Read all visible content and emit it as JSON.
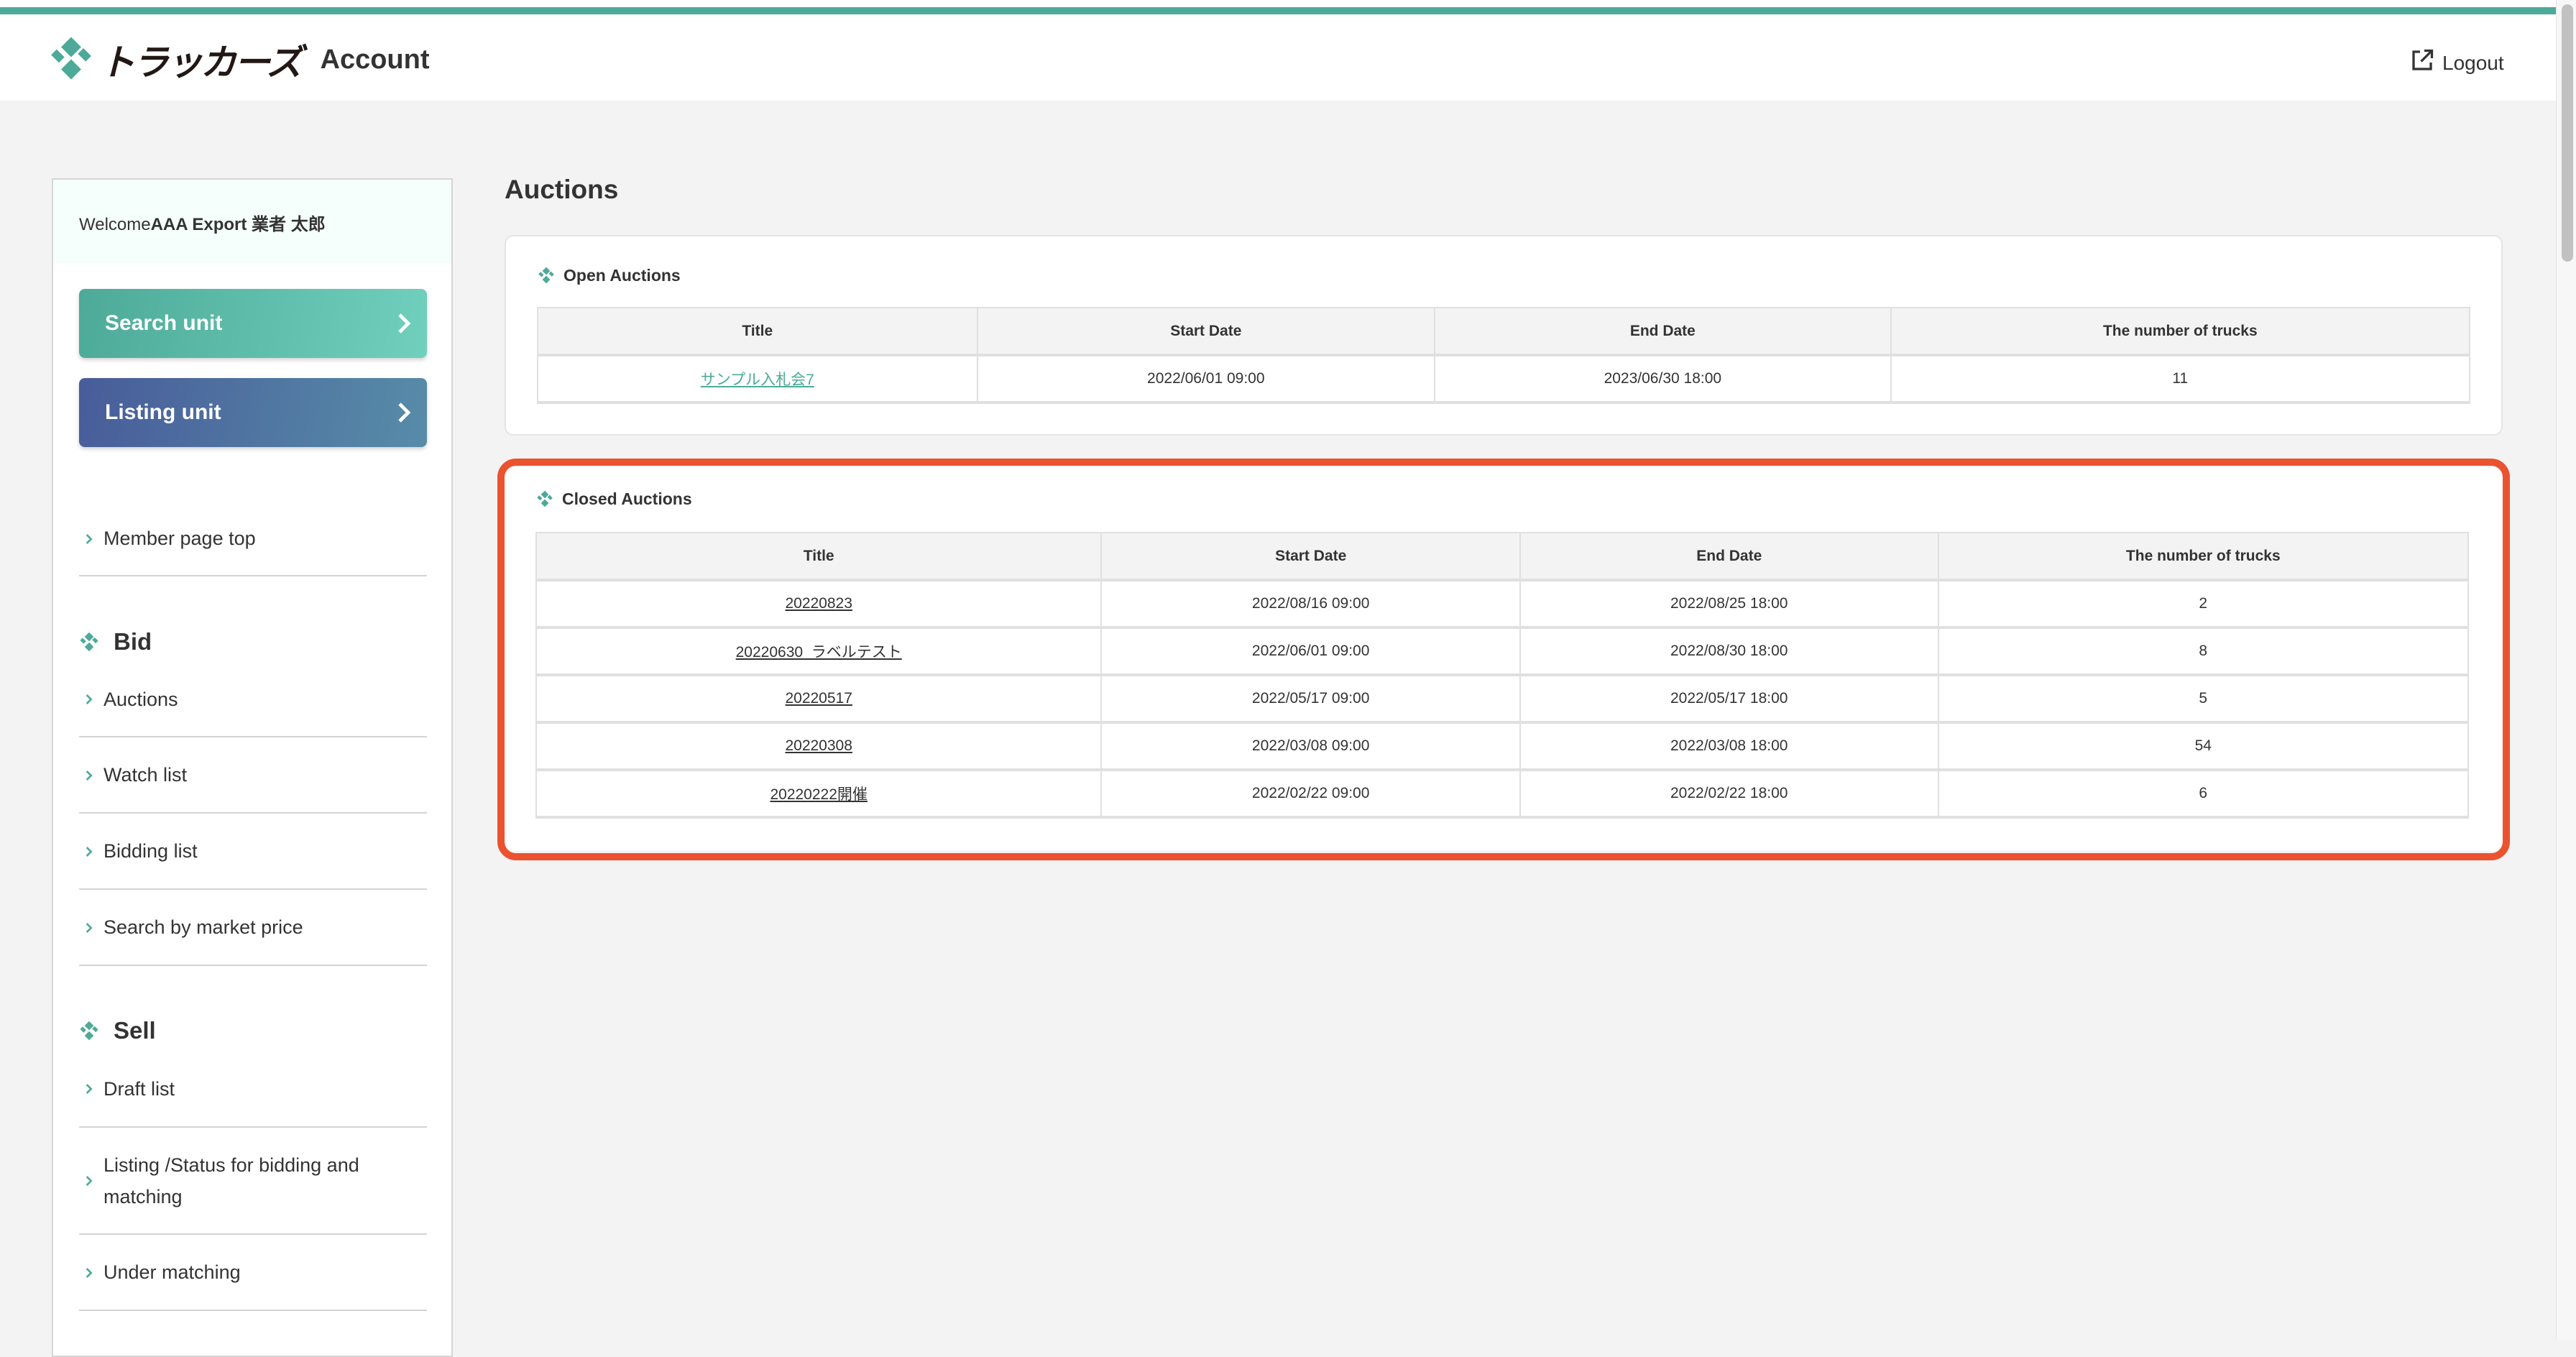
{
  "header": {
    "brand": "トラッカーズ",
    "app_title": "Account",
    "logout_label": "Logout"
  },
  "colors": {
    "accent": "#4daa98",
    "highlight": "#eb5230",
    "listing_button": "#485c9a"
  },
  "sidebar": {
    "welcome_prefix": "Welcome",
    "welcome_name": "AAA Export 業者 太郎",
    "search_unit_label": "Search unit",
    "listing_unit_label": "Listing unit",
    "top_items": [
      {
        "label": "Member page top"
      }
    ],
    "sections": [
      {
        "title": "Bid",
        "items": [
          {
            "label": "Auctions"
          },
          {
            "label": "Watch list"
          },
          {
            "label": "Bidding list"
          },
          {
            "label": "Search by market price"
          }
        ]
      },
      {
        "title": "Sell",
        "items": [
          {
            "label": "Draft list"
          },
          {
            "label": "Listing /Status for bidding and matching"
          },
          {
            "label": "Under matching"
          }
        ]
      }
    ]
  },
  "main": {
    "title": "Auctions",
    "open": {
      "title": "Open Auctions",
      "columns": [
        "Title",
        "Start Date",
        "End Date",
        "The number of trucks"
      ],
      "rows": [
        {
          "title": "サンプル入札会7",
          "start": "2022/06/01 09:00",
          "end": "2023/06/30 18:00",
          "trucks": "11"
        }
      ]
    },
    "closed": {
      "title": "Closed Auctions",
      "columns": [
        "Title",
        "Start Date",
        "End Date",
        "The number of trucks"
      ],
      "rows": [
        {
          "title": "20220823",
          "start": "2022/08/16 09:00",
          "end": "2022/08/25 18:00",
          "trucks": "2"
        },
        {
          "title": "20220630_ラベルテスト",
          "start": "2022/06/01 09:00",
          "end": "2022/08/30 18:00",
          "trucks": "8"
        },
        {
          "title": "20220517",
          "start": "2022/05/17 09:00",
          "end": "2022/05/17 18:00",
          "trucks": "5"
        },
        {
          "title": "20220308",
          "start": "2022/03/08 09:00",
          "end": "2022/03/08 18:00",
          "trucks": "54"
        },
        {
          "title": "20220222開催",
          "start": "2022/02/22 09:00",
          "end": "2022/02/22 18:00",
          "trucks": "6"
        }
      ]
    }
  }
}
